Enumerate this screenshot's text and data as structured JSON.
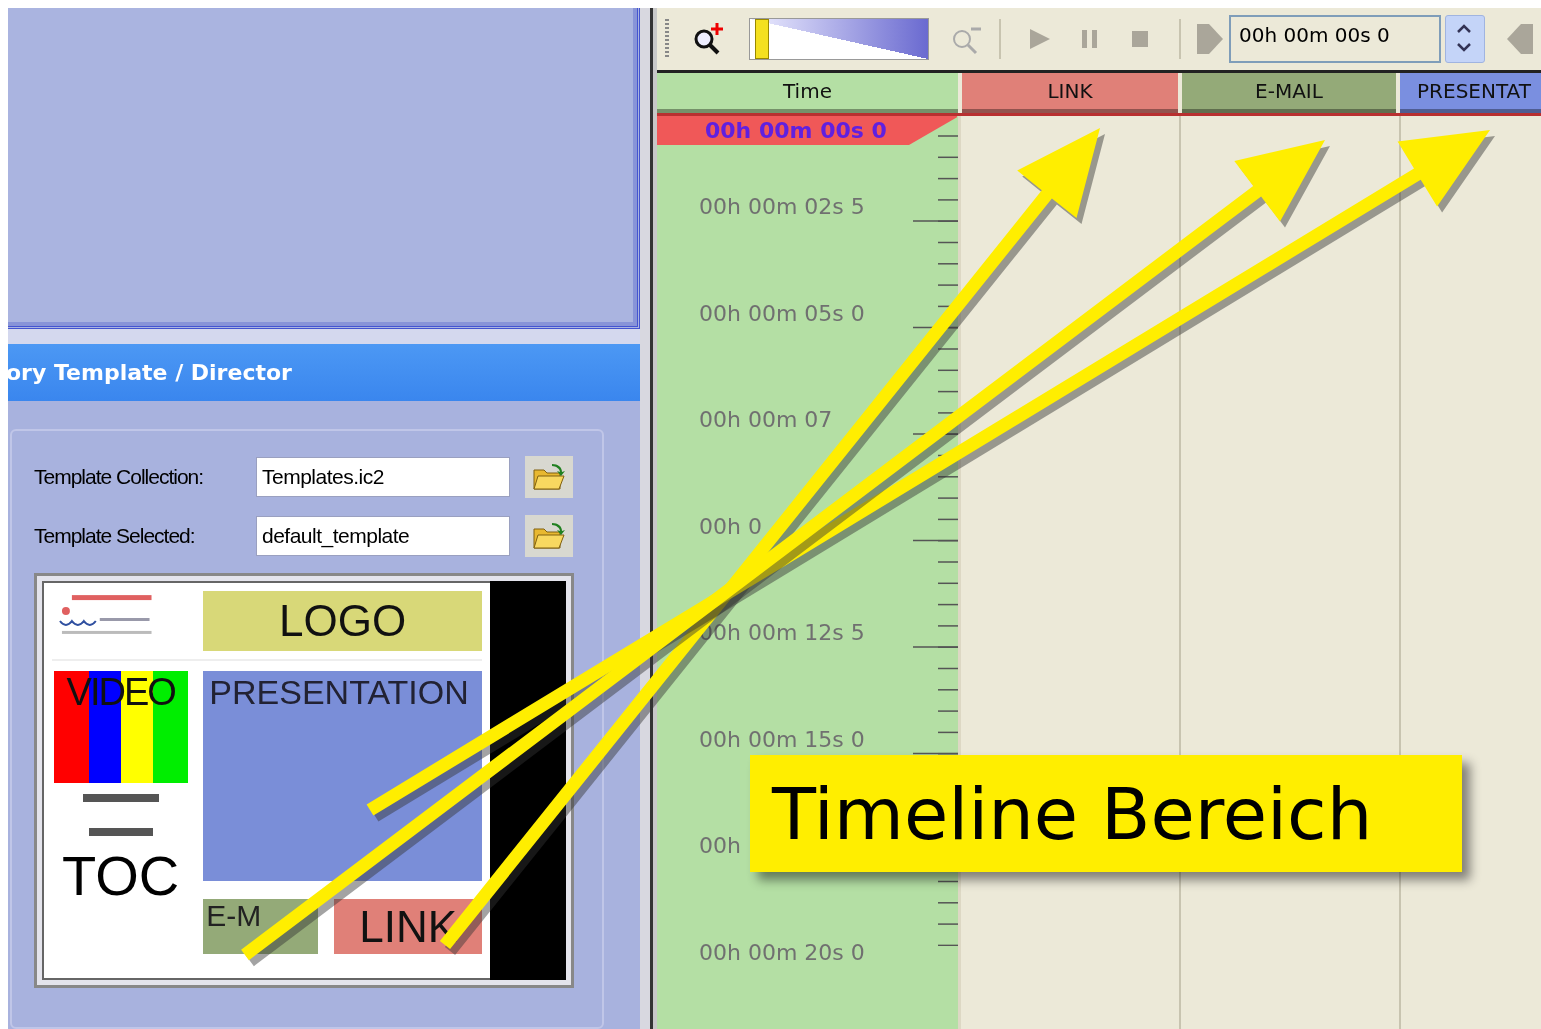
{
  "template_panel": {
    "title": "ory Template / Director",
    "fields": [
      {
        "label": "Template Collection:",
        "value": "Templates.ic2"
      },
      {
        "label": "Template Selected:",
        "value": "default_template"
      }
    ],
    "preview": {
      "logo": "LOGO",
      "video": "VIDEO",
      "presentation": "PRESENTATION",
      "toc": "TOC",
      "email": "E-M",
      "link": "LINK"
    }
  },
  "toolbar": {
    "zoom_slider": {
      "level": 0.03
    },
    "playback_buttons": [
      {
        "kind": "play",
        "disabled": true
      },
      {
        "kind": "pause",
        "disabled": true
      },
      {
        "kind": "stop",
        "disabled": true
      }
    ],
    "time_field": {
      "value": "00h 00m 00s 0"
    }
  },
  "timeline": {
    "columns": [
      {
        "label": "Time",
        "color": "#b4dfa4"
      },
      {
        "label": "LINK",
        "color": "#e08078"
      },
      {
        "label": "E-MAIL",
        "color": "#94aa78"
      },
      {
        "label": "PRESENTAT",
        "color": "#7a8fe0"
      }
    ],
    "current_time": "00h 00m 00s 0",
    "time_labels": [
      "00h 00m 02s 5",
      "00h 00m 05s 0",
      "00h 00m 07",
      "00h 0",
      "00h 00m 12s 5",
      "00h 00m 15s 0",
      "00h",
      "00h 00m 20s 0"
    ]
  },
  "callout": {
    "text": "Timeline Bereich"
  }
}
